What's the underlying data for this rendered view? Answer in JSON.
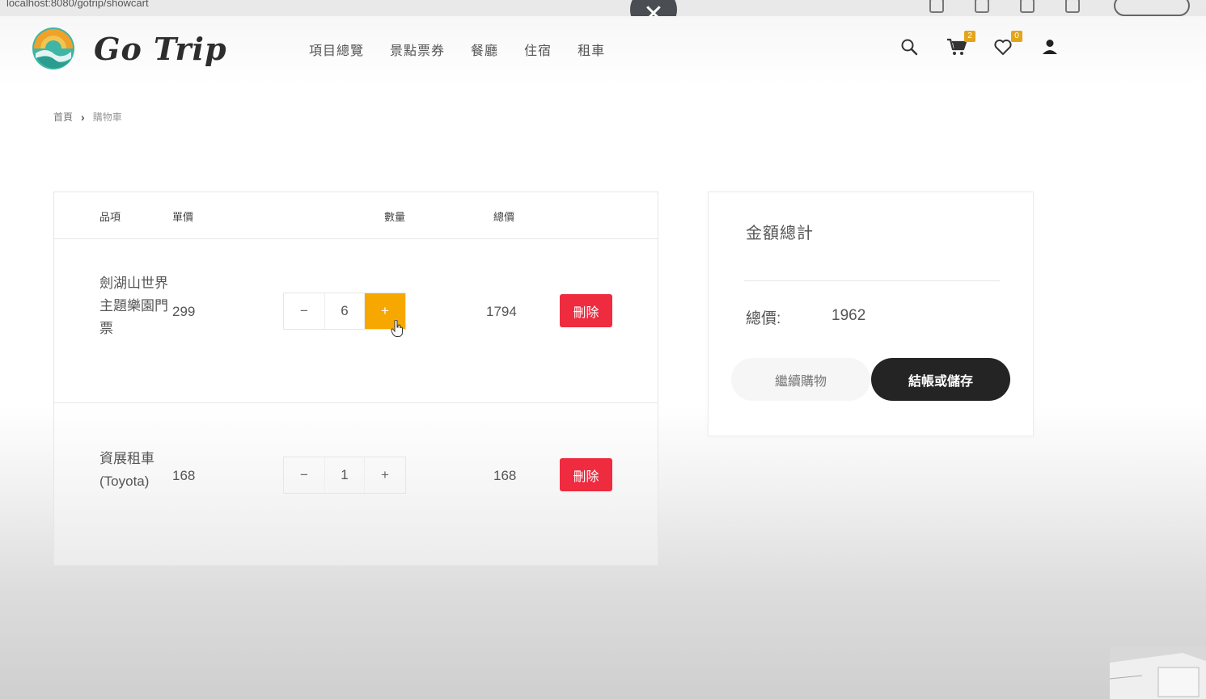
{
  "browser": {
    "address": "localhost:8080/gotrip/showcart"
  },
  "header": {
    "brand": "Go Trip",
    "nav": [
      "項目總覽",
      "景點票券",
      "餐廳",
      "住宿",
      "租車"
    ],
    "cart_count": "2",
    "wishlist_count": "0"
  },
  "breadcrumb": {
    "home": "首頁",
    "current": "購物車"
  },
  "cart": {
    "headers": {
      "item": "品項",
      "price": "單價",
      "qty": "數量",
      "total": "總價"
    },
    "rows": [
      {
        "name_lines": [
          "劍湖山世界",
          "主題樂園門",
          "票"
        ],
        "price": "299",
        "qty": "6",
        "total": "1794",
        "delete": "刪除"
      },
      {
        "name_lines": [
          "資展租車",
          "(Toyota)"
        ],
        "price": "168",
        "qty": "1",
        "total": "168",
        "delete": "刪除"
      }
    ],
    "minus_symbol": "−",
    "plus_symbol": "+"
  },
  "summary": {
    "title": "金額總計",
    "total_label": "總價:",
    "total_value": "1962",
    "continue_label": "繼續購物",
    "checkout_label": "結帳或儲存"
  },
  "colors": {
    "accent": "#f6a800",
    "delete": "#ee2b3f",
    "checkout": "#242424",
    "badge": "#e3a51a"
  }
}
